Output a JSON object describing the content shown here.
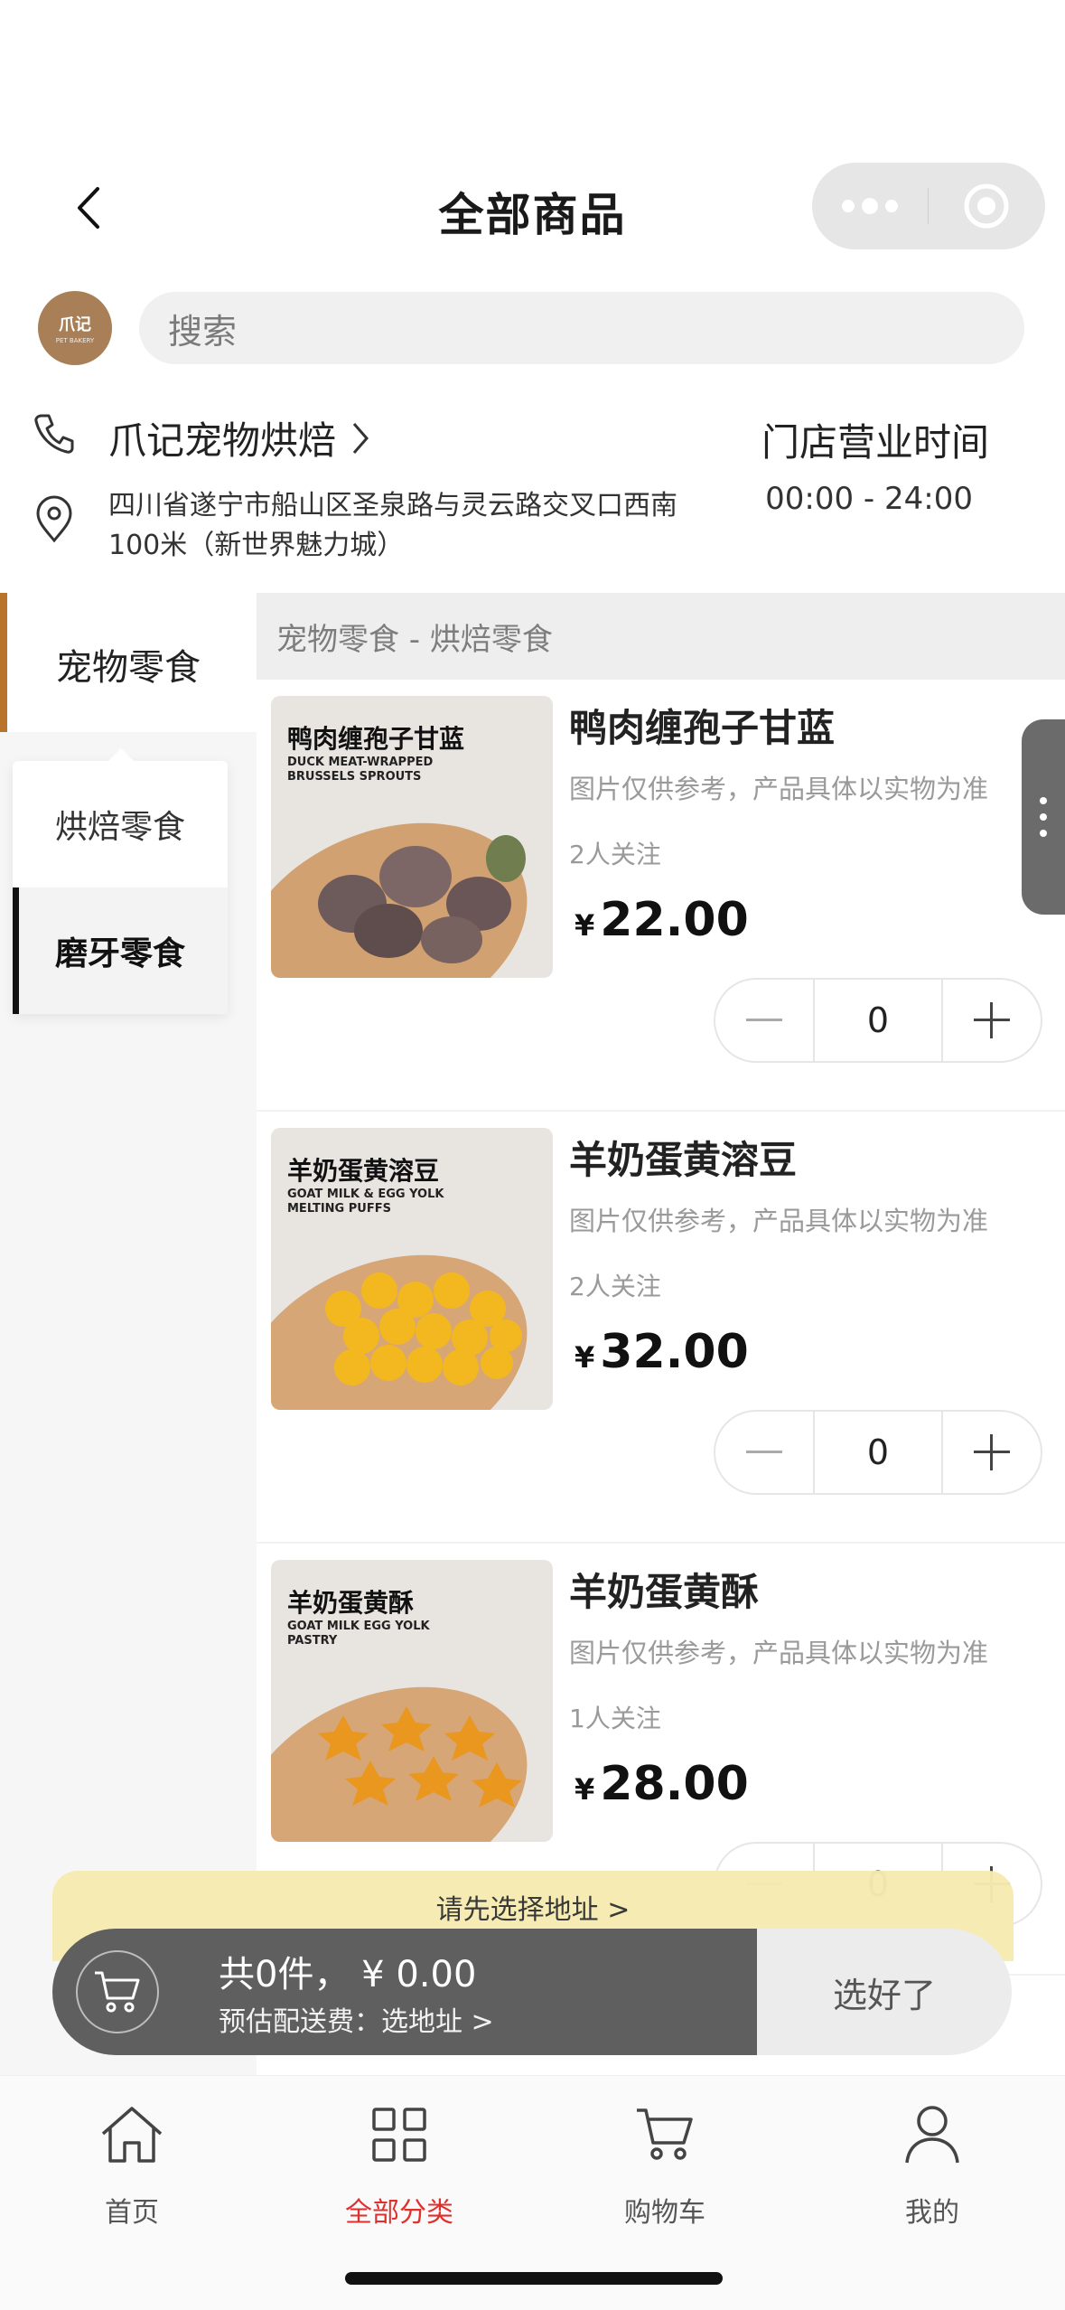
{
  "nav": {
    "title": "全部商品"
  },
  "search": {
    "placeholder": "搜索"
  },
  "logo": {
    "text": "爪记"
  },
  "store": {
    "name": "爪记宠物烘焙",
    "hours_label": "门店营业时间",
    "hours_value": "00:00 - 24:00",
    "address": "四川省遂宁市船山区圣泉路与灵云路交叉口西南100米（新世界魅力城）"
  },
  "categories": {
    "main": "宠物零食",
    "sub": [
      "烘焙零食",
      "磨牙零食"
    ]
  },
  "list_header": "宠物零食 - 烘焙零食",
  "products": [
    {
      "title": "鸭肉缠孢子甘蓝",
      "img_title": "鸭肉缠孢子甘蓝",
      "img_subtitle": "DUCK MEAT-WRAPPED BRUSSELS SPROUTS",
      "note": "图片仅供参考，产品具体以实物为准",
      "follow": "2人关注",
      "currency": "¥",
      "price": "22.00",
      "qty": "0"
    },
    {
      "title": "羊奶蛋黄溶豆",
      "img_title": "羊奶蛋黄溶豆",
      "img_subtitle": "GOAT MILK & EGG YOLK MELTING PUFFS",
      "note": "图片仅供参考，产品具体以实物为准",
      "follow": "2人关注",
      "currency": "¥",
      "price": "32.00",
      "qty": "0"
    },
    {
      "title": "羊奶蛋黄酥",
      "img_title": "羊奶蛋黄酥",
      "img_subtitle": "GOAT MILK EGG YOLK PASTRY",
      "note": "图片仅供参考，产品具体以实物为准",
      "follow": "1人关注",
      "currency": "¥",
      "price": "28.00",
      "qty": "0"
    }
  ],
  "cart": {
    "address_tip": "请先选择地址 >",
    "total": "共0件，  ¥ 0.00",
    "fee": "预估配送费：选地址 >",
    "checkout": "选好了"
  },
  "tabs": [
    {
      "label": "首页",
      "icon": "home-icon"
    },
    {
      "label": "全部分类",
      "icon": "grid-icon",
      "active": true
    },
    {
      "label": "购物车",
      "icon": "cart-icon"
    },
    {
      "label": "我的",
      "icon": "user-icon"
    }
  ],
  "colors": {
    "accent_bar": "#b8742a",
    "tab_active": "#e0302d",
    "tip_bg": "#f6ebb1"
  }
}
